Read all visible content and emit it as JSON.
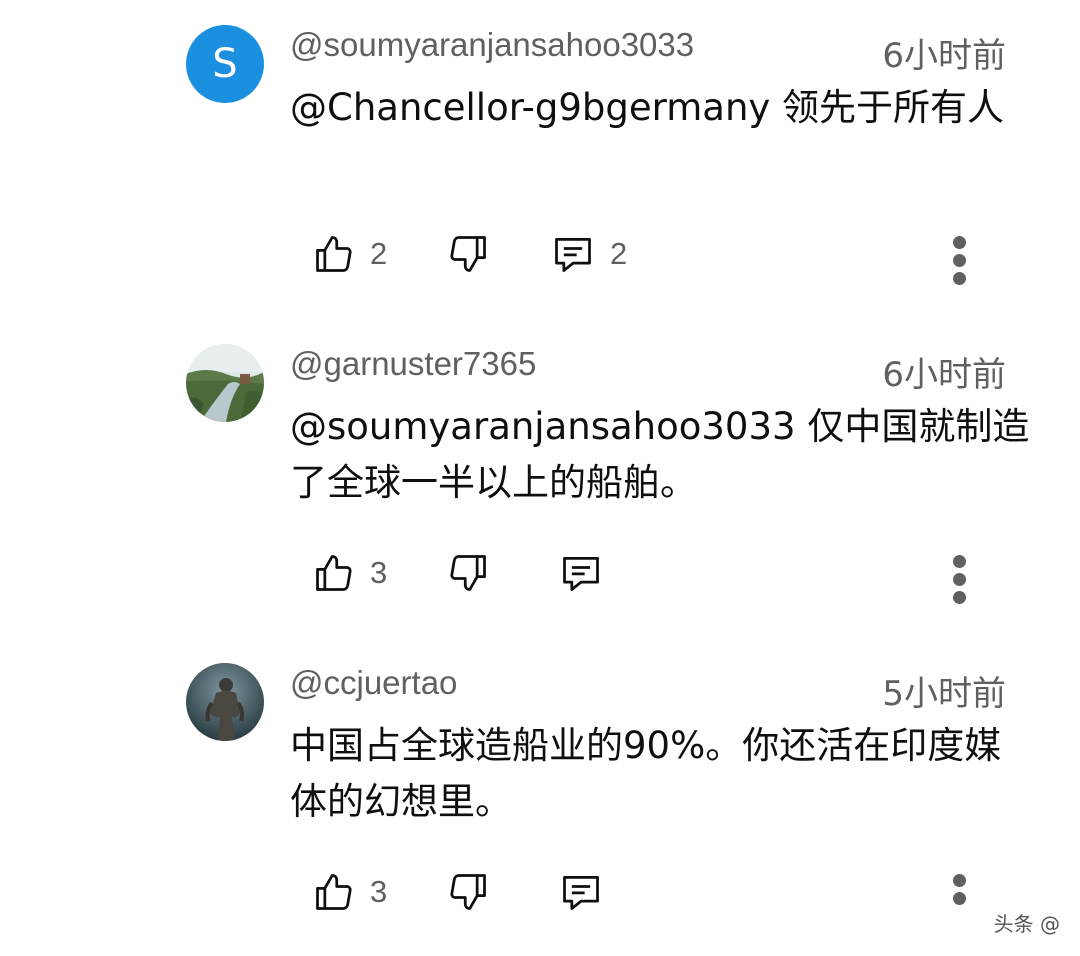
{
  "comments": [
    {
      "avatar_letter": "S",
      "avatar_color": "#1b8fe0",
      "handle": "@soumyaranjansahoo3033",
      "time": "6小时前",
      "text": "@Chancellor-g9bgermany 领先于所有人",
      "likes": "2",
      "replies": "2"
    },
    {
      "avatar_letter": "",
      "avatar_color": "",
      "handle": "@garnuster7365",
      "time": "6小时前",
      "text": "@soumyaranjansahoo3033 仅中国就制造了全球一半以上的船舶。",
      "likes": "3",
      "replies": ""
    },
    {
      "avatar_letter": "",
      "avatar_color": "",
      "handle": "@ccjuertao",
      "time": "5小时前",
      "text": "中国占全球造船业的90%。你还活在印度媒体的幻想里。",
      "likes": "3",
      "replies": ""
    }
  ],
  "watermark": "头条 @"
}
